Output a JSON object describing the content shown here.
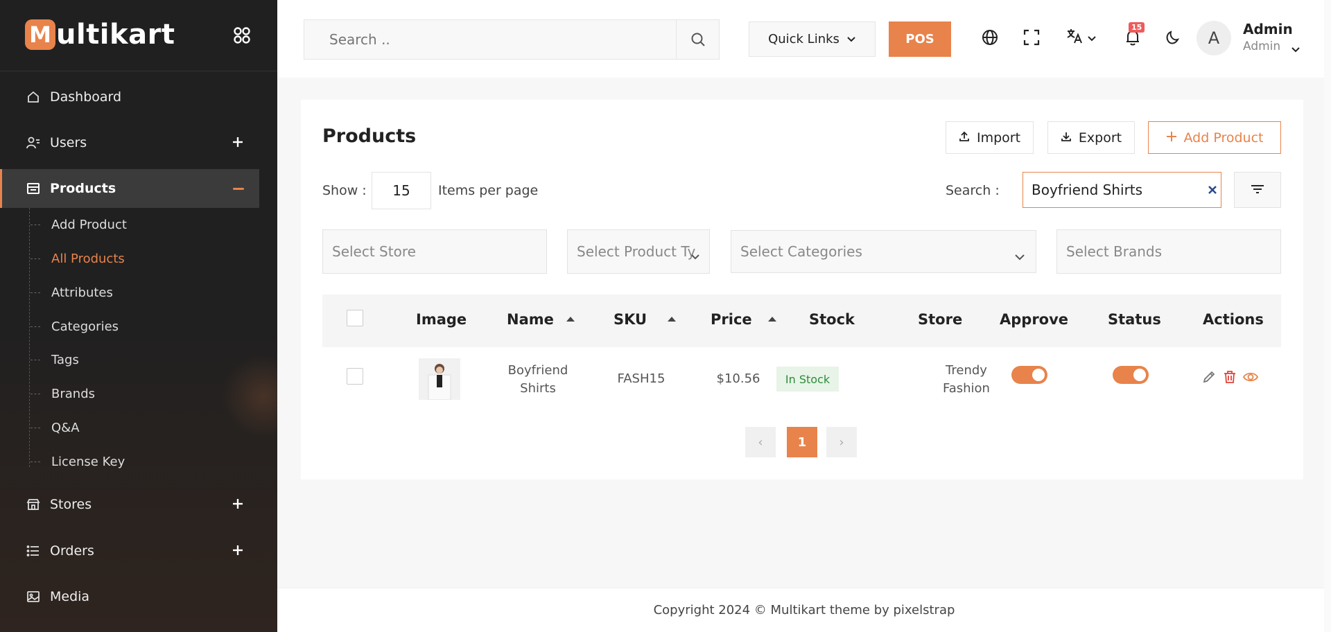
{
  "brand": {
    "mark": "M",
    "text": "ultikart"
  },
  "sidebar": {
    "items": [
      {
        "label": "Dashboard",
        "icon": "home-icon"
      },
      {
        "label": "Users",
        "icon": "users-icon"
      },
      {
        "label": "Products",
        "icon": "products-icon"
      },
      {
        "label": "Stores",
        "icon": "store-icon"
      },
      {
        "label": "Orders",
        "icon": "orders-icon"
      },
      {
        "label": "Media",
        "icon": "image-icon"
      }
    ],
    "products_sub": [
      {
        "label": "Add Product"
      },
      {
        "label": "All Products"
      },
      {
        "label": "Attributes"
      },
      {
        "label": "Categories"
      },
      {
        "label": "Tags"
      },
      {
        "label": "Brands"
      },
      {
        "label": "Q&A"
      },
      {
        "label": "License Key"
      }
    ]
  },
  "header": {
    "search_placeholder": "Search ..",
    "quick_links": "Quick Links",
    "pos": "POS",
    "notification_count": "15",
    "avatar_letter": "A",
    "user_name": "Admin",
    "user_role": "Admin"
  },
  "page": {
    "title": "Products",
    "import": "Import",
    "export": "Export",
    "add_product": "Add Product",
    "show_label": "Show :",
    "per_page_value": "15",
    "per_page_label": "Items per page",
    "search_label": "Search :",
    "search_value": "Boyfriend Shirts",
    "filters": {
      "store": "Select Store",
      "product_type": "Select Product Ty",
      "categories": "Select Categories",
      "brands": "Select Brands"
    }
  },
  "table": {
    "headers": {
      "image": "Image",
      "name": "Name",
      "sku": "SKU",
      "price": "Price",
      "stock": "Stock",
      "store": "Store",
      "approve": "Approve",
      "status": "Status",
      "actions": "Actions"
    },
    "rows": [
      {
        "name_line1": "Boyfriend",
        "name_line2": "Shirts",
        "sku": "FASH15",
        "price": "$10.56",
        "stock": "In Stock",
        "store_line1": "Trendy",
        "store_line2": "Fashion",
        "approved": true,
        "status": true
      }
    ]
  },
  "pagination": {
    "prev": "‹",
    "current": "1",
    "next": "›"
  },
  "footer": {
    "text": "Copyright 2024 © Multikart theme by pixelstrap"
  },
  "colors": {
    "accent": "#e8834b",
    "sidebar_bg": "#202020",
    "stock_bg": "#e7f4e7",
    "stock_text": "#2e8b3a"
  }
}
